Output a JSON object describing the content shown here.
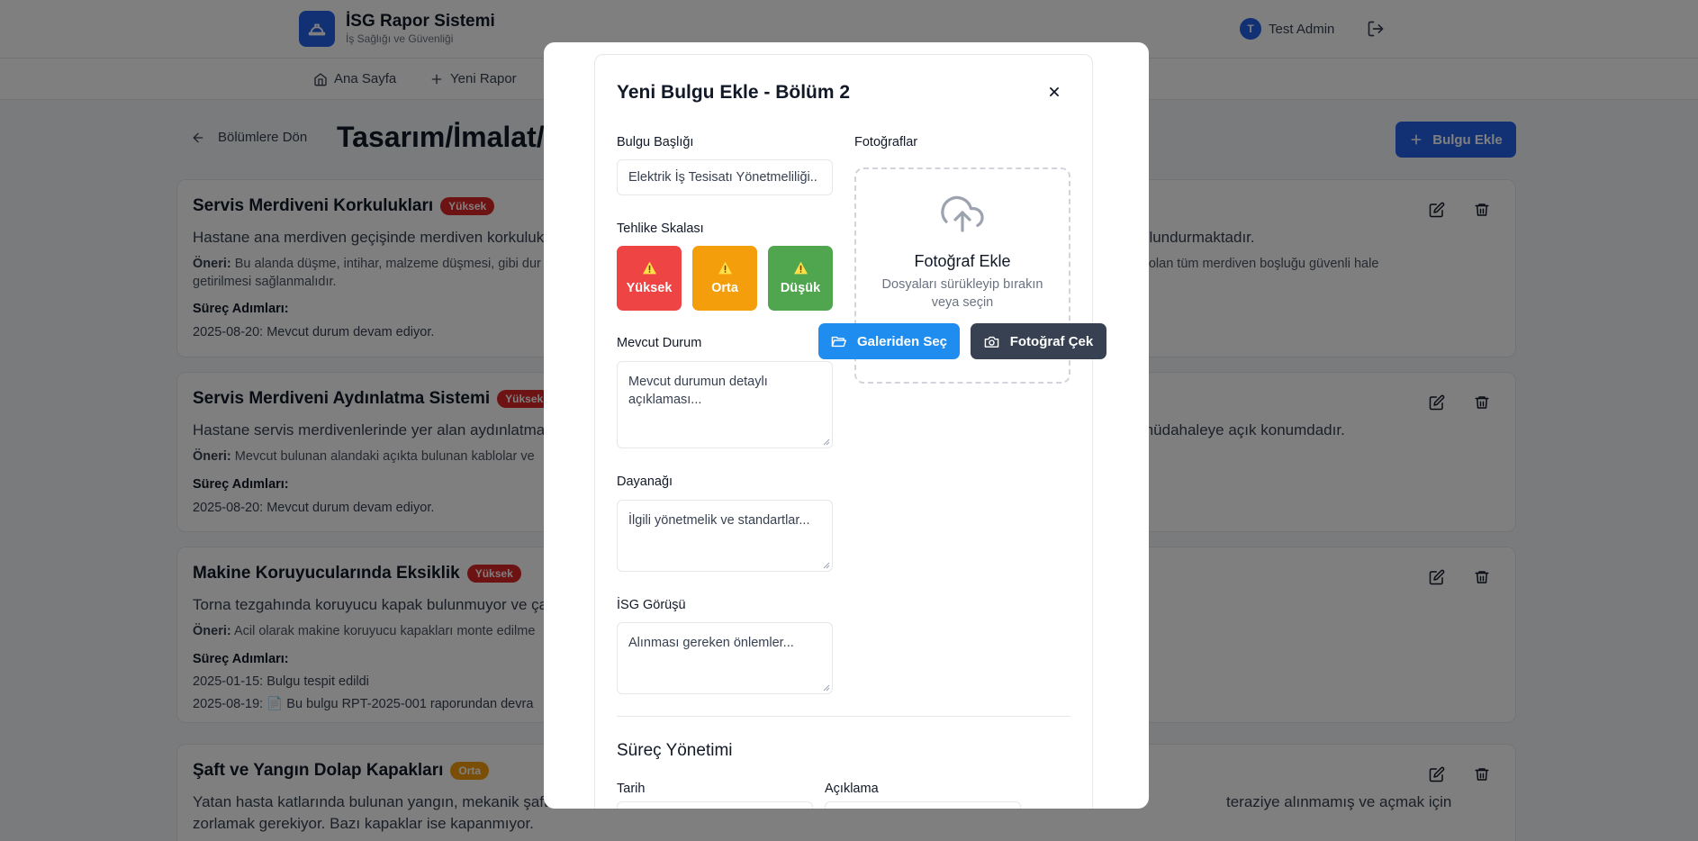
{
  "header": {
    "app_title": "İSG Rapor Sistemi",
    "app_subtitle": "İş Sağlığı ve Güvenliği",
    "user_initial": "T",
    "user_name": "Test Admin"
  },
  "nav": {
    "home": "Ana Sayfa",
    "new_report": "Yeni Rapor"
  },
  "page": {
    "back_label": "Bölümlere Dön",
    "title": "Tasarım/İmalat/",
    "add_finding_label": "Bulgu Ekle"
  },
  "findings": [
    {
      "title": "Servis Merdiveni Korkulukları",
      "severity": "Yüksek",
      "description": "Hastane ana merdiven geçişinde merdiven korkuluk",
      "description_end": "ulundurmaktadır.",
      "suggestion_label": "Öneri:",
      "suggestion": "Bu alanda düşme, intihar, malzeme düşmesi, gibi dur",
      "suggestion_end": "r olan tüm merdiven boşluğu güvenli hale",
      "suggestion_line2": "getirilmesi sağlanmalıdır.",
      "steps_label": "Süreç Adımları:",
      "steps": [
        "2025-08-20: Mevcut durum devam ediyor."
      ]
    },
    {
      "title": "Servis Merdiveni Aydınlatma Sistemi",
      "severity": "Yüksek",
      "description": "Hastane servis merdivenlerinde yer alan aydınlatma",
      "description_end": "müdahaleye açık konumdadır.",
      "suggestion_label": "Öneri:",
      "suggestion": "Mevcut bulunan alandaki açıkta bulunan kablolar ve",
      "steps_label": "Süreç Adımları:",
      "steps": [
        "2025-08-20: Mevcut durum devam ediyor."
      ]
    },
    {
      "title": "Makine Koruyucularında Eksiklik",
      "severity": "Yüksek",
      "description": "Torna tezgahında koruyucu kapak bulunmuyor ve ça",
      "suggestion_label": "Öneri:",
      "suggestion": "Acil olarak makine koruyucu kapakları monte edilme",
      "steps_label": "Süreç Adımları:",
      "steps": [
        "2025-01-15: Bulgu tespit edildi",
        "2025-08-19: 📄 Bu bulgu RPT-2025-001 raporundan devra"
      ]
    },
    {
      "title": "Şaft ve Yangın Dolap Kapakları",
      "severity": "Orta",
      "description": "Yatan hasta katlarında bulunan yangın, mekanik şaft",
      "description_end": "teraziye alınmamış ve açmak için",
      "description_line2": "zorlamak gerekiyor. Bazı kapaklar ise kapanmıyor."
    }
  ],
  "modal": {
    "title": "Yeni Bulgu Ekle - Bölüm 2",
    "close_symbol": "×",
    "finding_title_label": "Bulgu Başlığı",
    "finding_title_value": "Elektrik İş Tesisatı Yönetmeliliği..",
    "severity_label": "Tehlike Skalası",
    "severity_options": [
      "Yüksek",
      "Orta",
      "Düşük"
    ],
    "current_state_label": "Mevcut Durum",
    "current_state_placeholder": "Mevcut durumun detaylı açıklaması...",
    "basis_label": "Dayanağı",
    "basis_placeholder": "İlgili yönetmelik ve standartlar...",
    "opinion_label": "İSG Görüşü",
    "opinion_placeholder": "Alınması gereken önlemler...",
    "photos_label": "Fotoğraflar",
    "upload_title": "Fotoğraf Ekle",
    "upload_hint": "Dosyaları sürükleyip bırakın veya seçin",
    "gallery_button": "Galeriden Seç",
    "camera_button": "Fotoğraf Çek",
    "process_section_title": "Süreç Yönetimi",
    "date_label": "Tarih",
    "description_label": "Açıklama"
  },
  "colors": {
    "primary": "#2563eb",
    "high": "#ef4444",
    "medium": "#f59e0b",
    "low": "#4fa64f",
    "dark_button": "#374151"
  }
}
